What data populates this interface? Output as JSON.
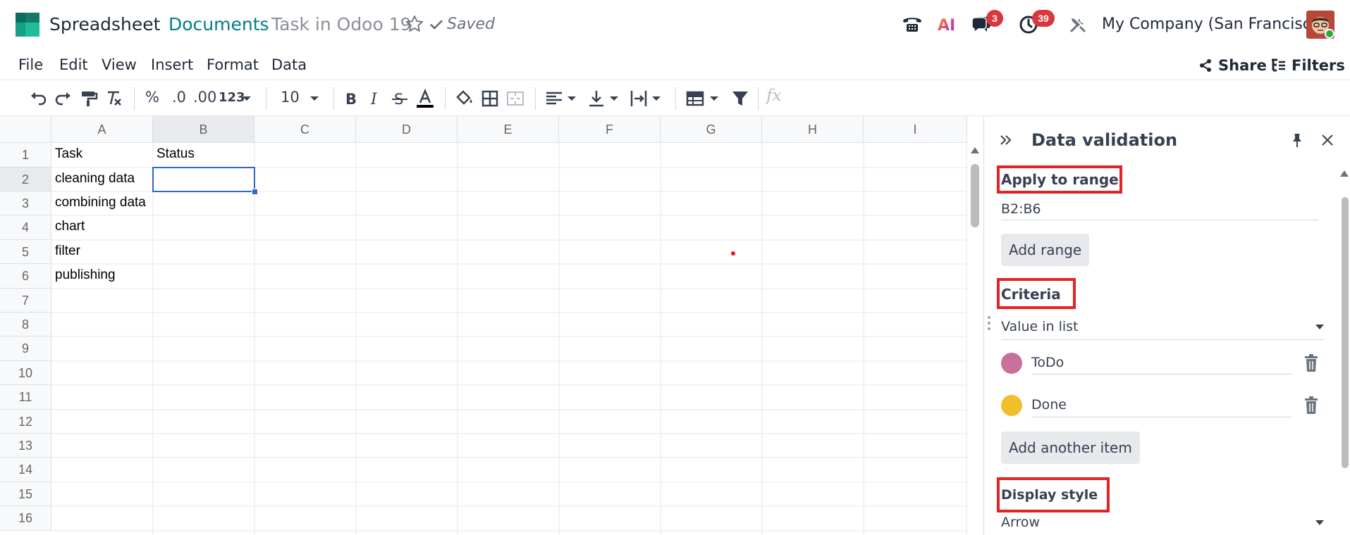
{
  "navbar": {
    "app_name": "Spreadsheet",
    "breadcrumb": "Documents",
    "document_name": "Task in Odoo 19",
    "saved_label": "Saved",
    "ai_label": "AI",
    "messages_badge": "3",
    "activities_badge": "39",
    "company": "My Company (San Francisco)"
  },
  "menu": {
    "items": [
      "File",
      "Edit",
      "View",
      "Insert",
      "Format",
      "Data"
    ],
    "share_label": "Share",
    "filters_label": "Filters"
  },
  "toolbar": {
    "percent": "%",
    "decimal_decrease": ".0",
    "decimal_increase": ".00",
    "number_format": "123",
    "font_size": "10",
    "formula_placeholder": "fx"
  },
  "grid": {
    "columns": [
      "A",
      "B",
      "C",
      "D",
      "E",
      "F",
      "G",
      "H",
      "I"
    ],
    "rows": [
      "1",
      "2",
      "3",
      "4",
      "5",
      "6",
      "7",
      "8",
      "9",
      "10",
      "11",
      "12",
      "13",
      "14",
      "15",
      "16"
    ],
    "cells": {
      "A1": "Task",
      "B1": "Status",
      "A2": "cleaning data",
      "A3": "combining data",
      "A4": "chart",
      "A5": "filter",
      "A6": "publishing"
    },
    "selected_cell": "B2",
    "selected_column": "B",
    "selected_row": "2"
  },
  "panel": {
    "title": "Data validation",
    "apply_label": "Apply to range",
    "range_value": "B2:B6",
    "add_range_label": "Add range",
    "criteria_label": "Criteria",
    "criteria_value": "Value in list",
    "items": [
      {
        "label": "ToDo",
        "color": "#c86f9c"
      },
      {
        "label": "Done",
        "color": "#f0bf2b"
      }
    ],
    "add_item_label": "Add another item",
    "display_label": "Display style",
    "display_value": "Arrow"
  },
  "colors": {
    "brand_teal": "#017e84",
    "selection_blue": "#3266ca",
    "annotation_red": "#e32326",
    "badge_red": "#d9363e"
  }
}
